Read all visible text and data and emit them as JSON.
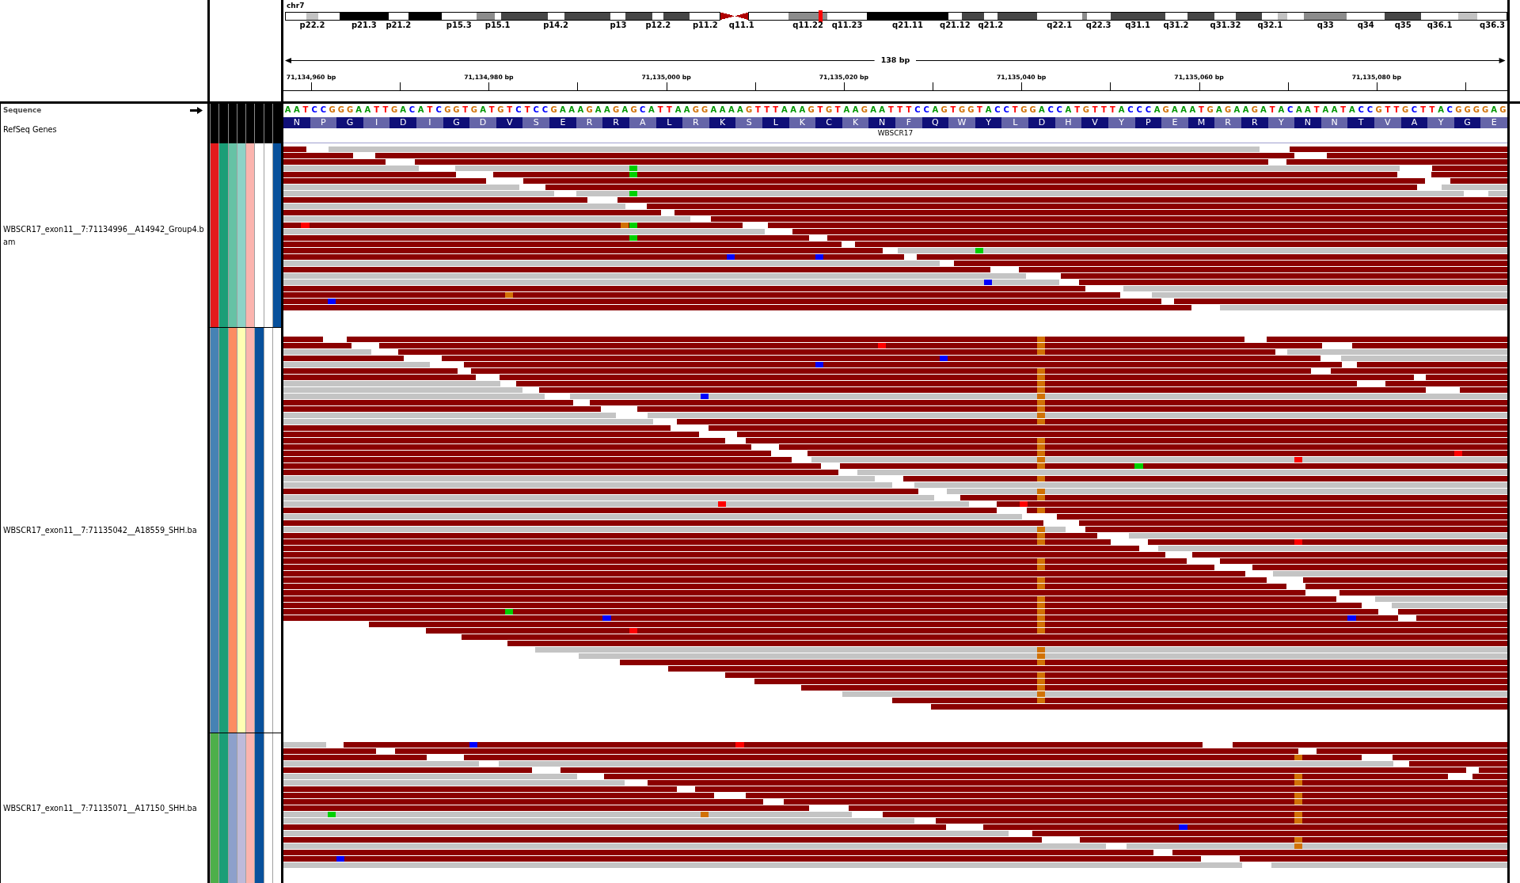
{
  "ideogram": {
    "chromosome": "chr7",
    "bands": [
      {
        "kind": "gneg"
      },
      {
        "label": "p22.2",
        "kind": "gpos25"
      },
      {
        "kind": "gneg"
      },
      {
        "label": "p21.3",
        "kind": "gpos100"
      },
      {
        "label": "p21.2",
        "kind": "gneg"
      },
      {
        "kind": "gpos100"
      },
      {
        "label": "p15.3",
        "kind": "gneg"
      },
      {
        "kind": "gpos50"
      },
      {
        "label": "p15.1",
        "kind": "gneg"
      },
      {
        "kind": "gpos75"
      },
      {
        "label": "p14.2",
        "kind": "gneg"
      },
      {
        "kind": "gpos75"
      },
      {
        "label": "p13",
        "kind": "gneg"
      },
      {
        "kind": "gpos75"
      },
      {
        "label": "p12.2",
        "kind": "gneg"
      },
      {
        "kind": "gpos75"
      },
      {
        "label": "p11.2",
        "kind": "gneg"
      },
      {
        "kind": "acen"
      },
      {
        "label": "q11.1",
        "kind": "acen"
      },
      {
        "kind": "gneg"
      },
      {
        "label": "q11.22",
        "kind": "gpos50"
      },
      {
        "label": "q11.23",
        "kind": "gneg"
      },
      {
        "label": "q21.11",
        "kind": "gpos100"
      },
      {
        "label": "q21.12",
        "kind": "gneg"
      },
      {
        "kind": "gpos75"
      },
      {
        "label": "q21.2",
        "kind": "gneg"
      },
      {
        "kind": "gpos75"
      },
      {
        "label": "q22.1",
        "kind": "gneg"
      },
      {
        "kind": "gpos50"
      },
      {
        "label": "q22.3",
        "kind": "gneg"
      },
      {
        "label": "q31.1",
        "kind": "gpos75"
      },
      {
        "label": "q31.2",
        "kind": "gneg"
      },
      {
        "kind": "gpos75"
      },
      {
        "label": "q31.32",
        "kind": "gneg"
      },
      {
        "kind": "gpos75"
      },
      {
        "label": "q32.1",
        "kind": "gneg"
      },
      {
        "kind": "gpos25"
      },
      {
        "kind": "gneg"
      },
      {
        "label": "q33",
        "kind": "gpos50"
      },
      {
        "label": "q34",
        "kind": "gneg"
      },
      {
        "label": "q35",
        "kind": "gpos75"
      },
      {
        "label": "q36.1",
        "kind": "gneg"
      },
      {
        "kind": "gpos25"
      },
      {
        "label": "q36.3",
        "kind": "gneg"
      }
    ]
  },
  "ruler": {
    "span": "138 bp",
    "ticks": [
      "71,134,960 bp",
      "71,134,980 bp",
      "71,135,000 bp",
      "71,135,020 bp",
      "71,135,040 bp",
      "71,135,060 bp",
      "71,135,080 bp"
    ]
  },
  "sequence_track": {
    "name": "Sequence",
    "bases": [
      {
        "base": "A",
        "color": "#009600"
      },
      {
        "base": "A",
        "color": "#009600"
      },
      {
        "base": "T",
        "color": "#ff0000"
      },
      {
        "base": "C",
        "color": "#0000ff"
      },
      {
        "base": "C",
        "color": "#0000ff"
      },
      {
        "base": "G",
        "color": "#d17105"
      },
      {
        "base": "G",
        "color": "#d17105"
      },
      {
        "base": "G",
        "color": "#d17105"
      },
      {
        "base": "A",
        "color": "#009600"
      },
      {
        "base": "A",
        "color": "#009600"
      },
      {
        "base": "T",
        "color": "#ff0000"
      },
      {
        "base": "T",
        "color": "#ff0000"
      },
      {
        "base": "G",
        "color": "#d17105"
      },
      {
        "base": "A",
        "color": "#009600"
      },
      {
        "base": "C",
        "color": "#0000ff"
      },
      {
        "base": "A",
        "color": "#009600"
      },
      {
        "base": "T",
        "color": "#ff0000"
      },
      {
        "base": "C",
        "color": "#0000ff"
      },
      {
        "base": "G",
        "color": "#d17105"
      },
      {
        "base": "G",
        "color": "#d17105"
      },
      {
        "base": "T",
        "color": "#ff0000"
      },
      {
        "base": "G",
        "color": "#d17105"
      },
      {
        "base": "A",
        "color": "#009600"
      },
      {
        "base": "T",
        "color": "#ff0000"
      },
      {
        "base": "G",
        "color": "#d17105"
      },
      {
        "base": "T",
        "color": "#ff0000"
      },
      {
        "base": "C",
        "color": "#0000ff"
      },
      {
        "base": "T",
        "color": "#ff0000"
      },
      {
        "base": "C",
        "color": "#0000ff"
      },
      {
        "base": "C",
        "color": "#0000ff"
      },
      {
        "base": "G",
        "color": "#d17105"
      },
      {
        "base": "A",
        "color": "#009600"
      },
      {
        "base": "A",
        "color": "#009600"
      },
      {
        "base": "A",
        "color": "#009600"
      },
      {
        "base": "G",
        "color": "#d17105"
      },
      {
        "base": "A",
        "color": "#009600"
      },
      {
        "base": "A",
        "color": "#009600"
      },
      {
        "base": "G",
        "color": "#d17105"
      },
      {
        "base": "A",
        "color": "#009600"
      },
      {
        "base": "G",
        "color": "#d17105"
      },
      {
        "base": "C",
        "color": "#0000ff"
      },
      {
        "base": "A",
        "color": "#009600"
      },
      {
        "base": "T",
        "color": "#ff0000"
      },
      {
        "base": "T",
        "color": "#ff0000"
      },
      {
        "base": "A",
        "color": "#009600"
      },
      {
        "base": "A",
        "color": "#009600"
      },
      {
        "base": "G",
        "color": "#d17105"
      },
      {
        "base": "G",
        "color": "#d17105"
      },
      {
        "base": "A",
        "color": "#009600"
      },
      {
        "base": "A",
        "color": "#009600"
      },
      {
        "base": "A",
        "color": "#009600"
      },
      {
        "base": "A",
        "color": "#009600"
      },
      {
        "base": "G",
        "color": "#d17105"
      },
      {
        "base": "T",
        "color": "#ff0000"
      },
      {
        "base": "T",
        "color": "#ff0000"
      },
      {
        "base": "T",
        "color": "#ff0000"
      },
      {
        "base": "A",
        "color": "#009600"
      },
      {
        "base": "A",
        "color": "#009600"
      },
      {
        "base": "A",
        "color": "#009600"
      },
      {
        "base": "G",
        "color": "#d17105"
      },
      {
        "base": "T",
        "color": "#ff0000"
      },
      {
        "base": "G",
        "color": "#d17105"
      },
      {
        "base": "T",
        "color": "#ff0000"
      },
      {
        "base": "A",
        "color": "#009600"
      },
      {
        "base": "A",
        "color": "#009600"
      },
      {
        "base": "G",
        "color": "#d17105"
      },
      {
        "base": "A",
        "color": "#009600"
      },
      {
        "base": "A",
        "color": "#009600"
      },
      {
        "base": "T",
        "color": "#ff0000"
      },
      {
        "base": "T",
        "color": "#ff0000"
      },
      {
        "base": "T",
        "color": "#ff0000"
      },
      {
        "base": "C",
        "color": "#0000ff"
      },
      {
        "base": "C",
        "color": "#0000ff"
      },
      {
        "base": "A",
        "color": "#009600"
      },
      {
        "base": "G",
        "color": "#d17105"
      },
      {
        "base": "T",
        "color": "#ff0000"
      },
      {
        "base": "G",
        "color": "#d17105"
      },
      {
        "base": "G",
        "color": "#d17105"
      },
      {
        "base": "T",
        "color": "#ff0000"
      },
      {
        "base": "A",
        "color": "#009600"
      },
      {
        "base": "C",
        "color": "#0000ff"
      },
      {
        "base": "C",
        "color": "#0000ff"
      },
      {
        "base": "T",
        "color": "#ff0000"
      },
      {
        "base": "G",
        "color": "#d17105"
      },
      {
        "base": "G",
        "color": "#d17105"
      },
      {
        "base": "A",
        "color": "#009600"
      },
      {
        "base": "C",
        "color": "#0000ff"
      },
      {
        "base": "C",
        "color": "#0000ff"
      },
      {
        "base": "A",
        "color": "#009600"
      },
      {
        "base": "T",
        "color": "#ff0000"
      },
      {
        "base": "G",
        "color": "#d17105"
      },
      {
        "base": "T",
        "color": "#ff0000"
      },
      {
        "base": "T",
        "color": "#ff0000"
      },
      {
        "base": "T",
        "color": "#ff0000"
      },
      {
        "base": "A",
        "color": "#009600"
      },
      {
        "base": "C",
        "color": "#0000ff"
      },
      {
        "base": "C",
        "color": "#0000ff"
      },
      {
        "base": "C",
        "color": "#0000ff"
      },
      {
        "base": "A",
        "color": "#009600"
      },
      {
        "base": "G",
        "color": "#d17105"
      },
      {
        "base": "A",
        "color": "#009600"
      },
      {
        "base": "A",
        "color": "#009600"
      },
      {
        "base": "A",
        "color": "#009600"
      },
      {
        "base": "T",
        "color": "#ff0000"
      },
      {
        "base": "G",
        "color": "#d17105"
      },
      {
        "base": "A",
        "color": "#009600"
      },
      {
        "base": "G",
        "color": "#d17105"
      },
      {
        "base": "A",
        "color": "#009600"
      },
      {
        "base": "A",
        "color": "#009600"
      },
      {
        "base": "G",
        "color": "#d17105"
      },
      {
        "base": "A",
        "color": "#009600"
      },
      {
        "base": "T",
        "color": "#ff0000"
      },
      {
        "base": "A",
        "color": "#009600"
      },
      {
        "base": "C",
        "color": "#0000ff"
      },
      {
        "base": "A",
        "color": "#009600"
      },
      {
        "base": "A",
        "color": "#009600"
      },
      {
        "base": "T",
        "color": "#ff0000"
      },
      {
        "base": "A",
        "color": "#009600"
      },
      {
        "base": "A",
        "color": "#009600"
      },
      {
        "base": "T",
        "color": "#ff0000"
      },
      {
        "base": "A",
        "color": "#009600"
      },
      {
        "base": "C",
        "color": "#0000ff"
      },
      {
        "base": "C",
        "color": "#0000ff"
      },
      {
        "base": "G",
        "color": "#d17105"
      },
      {
        "base": "T",
        "color": "#ff0000"
      },
      {
        "base": "T",
        "color": "#ff0000"
      },
      {
        "base": "G",
        "color": "#d17105"
      },
      {
        "base": "C",
        "color": "#0000ff"
      },
      {
        "base": "T",
        "color": "#ff0000"
      },
      {
        "base": "T",
        "color": "#ff0000"
      },
      {
        "base": "A",
        "color": "#009600"
      },
      {
        "base": "C",
        "color": "#0000ff"
      },
      {
        "base": "G",
        "color": "#d17105"
      },
      {
        "base": "G",
        "color": "#d17105"
      },
      {
        "base": "G",
        "color": "#d17105"
      },
      {
        "base": "G",
        "color": "#d17105"
      },
      {
        "base": "A",
        "color": "#009600"
      },
      {
        "base": "G",
        "color": "#d17105"
      }
    ]
  },
  "gene_track": {
    "name": "RefSeq Genes",
    "gene": "WBSCR17",
    "amino_acids": [
      "N",
      "P",
      "G",
      "I",
      "D",
      "I",
      "G",
      "D",
      "V",
      "S",
      "E",
      "R",
      "R",
      "A",
      "L",
      "R",
      "K",
      "S",
      "L",
      "K",
      "C",
      "K",
      "N",
      "F",
      "Q",
      "W",
      "Y",
      "L",
      "D",
      "H",
      "V",
      "Y",
      "P",
      "E",
      "M",
      "R",
      "R",
      "Y",
      "N",
      "N",
      "T",
      "V",
      "A",
      "Y",
      "G",
      "E"
    ]
  },
  "alignment_tracks": [
    {
      "name": "WBSCR17_exon11__7:71134996__A14942_Group4.bam",
      "attributes": [
        {
          "color": "#e41a1c"
        },
        {
          "color": "#1b9e77"
        },
        {
          "color": "#66c2a5"
        },
        {
          "color": "#8dd3c7"
        },
        {
          "color": "#fbb4ae"
        },
        {
          "color": "#ffffff"
        },
        {
          "color": "#ffffff"
        },
        {
          "color": "#08519c"
        }
      ]
    },
    {
      "name": "WBSCR17_exon11__7:71135042__A18559_SHH.ba",
      "attributes": [
        {
          "color": "#4682b4"
        },
        {
          "color": "#1b9e77"
        },
        {
          "color": "#fc8d62"
        },
        {
          "color": "#ffffb3"
        },
        {
          "color": "#fbb4ae"
        },
        {
          "color": "#08519c"
        },
        {
          "color": "#ffffff"
        },
        {
          "color": "#ffffff"
        }
      ]
    },
    {
      "name": "WBSCR17_exon11__7:71135071__A17150_SHH.ba",
      "attributes": [
        {
          "color": "#4daf4a"
        },
        {
          "color": "#1b9e77"
        },
        {
          "color": "#8da0cb"
        },
        {
          "color": "#bebada"
        },
        {
          "color": "#fbb4ae"
        },
        {
          "color": "#08519c"
        },
        {
          "color": "#ffffff"
        },
        {
          "color": "#ffffff"
        }
      ]
    }
  ]
}
